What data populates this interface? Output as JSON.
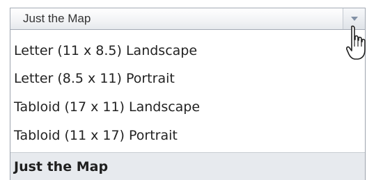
{
  "select": {
    "value": "Just the Map",
    "icon": "chevron-down-icon",
    "options": [
      "Letter (11 x 8.5) Landscape",
      "Letter (8.5 x 11) Portrait",
      "Tabloid (17 x 11) Landscape",
      "Tabloid (11 x 17) Portrait",
      "Just the Map"
    ],
    "selected_option": "Just the Map"
  },
  "cursor": {
    "icon": "hand-pointer-icon"
  },
  "colors": {
    "border": "#a3aab4",
    "arrow": "#8190a5",
    "selected_background": "#e7eaee"
  }
}
